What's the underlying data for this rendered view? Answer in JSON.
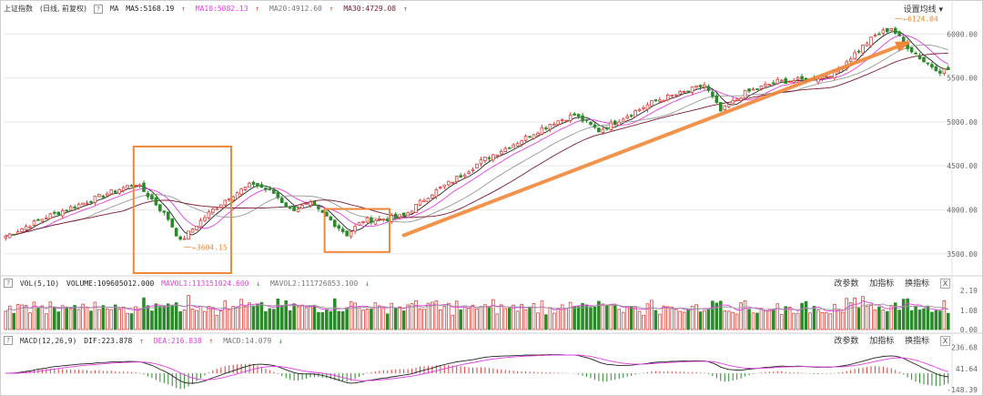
{
  "header": {
    "title": "上证指数",
    "subtitle": "(日线, 前复权)",
    "ma_label": "MA",
    "ma5": "MA5:5168.19",
    "ma10": "MA10:5082.13",
    "ma20": "MA20:4912.60",
    "ma30": "MA30:4729.08",
    "settings_label": "设置均线",
    "arrow_glyph": "↑"
  },
  "vol_header": {
    "label": "VOL(5,10)",
    "volume": "VOLUME:109605012.000",
    "mavol1": "MAVOL1:113151024.600",
    "mavol2": "MAVOL2:111726853.100",
    "down_glyph": "↓"
  },
  "macd_header": {
    "label": "MACD(12,26,9)",
    "dif": "DIF:223.878",
    "dea": "DEA:216.838",
    "macd": "MACD:14.079"
  },
  "panel_buttons": {
    "change_params": "改参数",
    "add_indicator": "加指标",
    "switch_indicator": "换指标",
    "close": "X",
    "help": "?"
  },
  "colors": {
    "up": "#d9413b",
    "down": "#2a8a2a",
    "ma5": "#222222",
    "ma10": "#e040e0",
    "ma20": "#999999",
    "ma30": "#7a1a30",
    "annotation": "#f0883a",
    "grid": "#e8e8e8"
  },
  "chart_data": {
    "type": "candlestick",
    "price_axis_ticks": [
      "6000.00",
      "5500.00",
      "5000.00",
      "4500.00",
      "4000.00",
      "3500.00"
    ],
    "price_ticks_values": [
      6000,
      5500,
      5000,
      4500,
      4000,
      3500
    ],
    "ylim": [
      3280,
      6200
    ],
    "annotations": [
      {
        "text": "3604.15",
        "at_index": 43,
        "value": 3604.15
      },
      {
        "text": "6124.04",
        "at_index": 218,
        "value": 6124.04
      }
    ],
    "boxes": [
      {
        "from_index": 32,
        "to_index": 55,
        "low": 3280,
        "high": 4720
      },
      {
        "from_index": 79,
        "to_index": 94,
        "low": 3520,
        "high": 4010
      }
    ],
    "trend_line": {
      "from_index": 98,
      "from_value": 3710,
      "to_index": 222,
      "to_value": 5900
    },
    "volume": {
      "axis_ticks": [
        "2.19",
        "1.08",
        "0.00"
      ],
      "tick_values": [
        2.19,
        1.08,
        0.0
      ],
      "ylim": [
        0,
        2.35
      ]
    },
    "macd": {
      "axis_ticks": [
        "236.68",
        "41.64",
        "-148.39"
      ],
      "tick_values": [
        236.68,
        41.64,
        -148.39
      ],
      "ylim": [
        -165,
        250
      ]
    },
    "seed_ohlc": [
      [
        0,
        3700
      ],
      [
        10,
        3920
      ],
      [
        18,
        4060
      ],
      [
        26,
        4200
      ],
      [
        32,
        4300
      ],
      [
        36,
        4120
      ],
      [
        40,
        3900
      ],
      [
        43,
        3640
      ],
      [
        47,
        3830
      ],
      [
        50,
        3960
      ],
      [
        55,
        4150
      ],
      [
        61,
        4300
      ],
      [
        66,
        4190
      ],
      [
        70,
        4000
      ],
      [
        75,
        4060
      ],
      [
        79,
        3920
      ],
      [
        84,
        3720
      ],
      [
        88,
        3880
      ],
      [
        94,
        3900
      ],
      [
        98,
        3930
      ],
      [
        104,
        4160
      ],
      [
        110,
        4330
      ],
      [
        118,
        4580
      ],
      [
        126,
        4770
      ],
      [
        134,
        4980
      ],
      [
        140,
        5080
      ],
      [
        146,
        4900
      ],
      [
        152,
        5050
      ],
      [
        160,
        5240
      ],
      [
        168,
        5350
      ],
      [
        172,
        5420
      ],
      [
        176,
        5120
      ],
      [
        182,
        5330
      ],
      [
        190,
        5460
      ],
      [
        198,
        5480
      ],
      [
        204,
        5560
      ],
      [
        210,
        5820
      ],
      [
        214,
        5980
      ],
      [
        218,
        6070
      ],
      [
        221,
        5900
      ],
      [
        226,
        5690
      ],
      [
        230,
        5580
      ]
    ]
  }
}
